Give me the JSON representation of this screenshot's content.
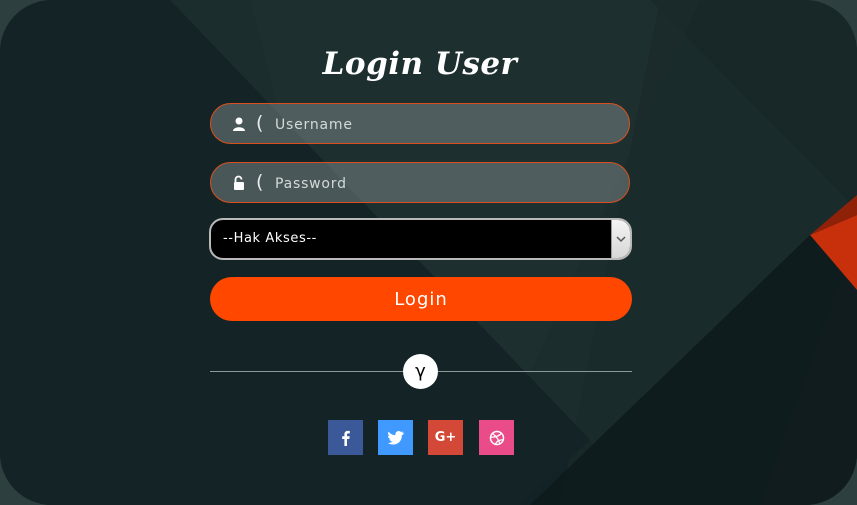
{
  "title": "Login User",
  "username": {
    "placeholder": "Username",
    "prefix": "(",
    "icon": "user-icon"
  },
  "password": {
    "placeholder": "Password",
    "prefix": "(",
    "icon": "unlock-icon"
  },
  "access": {
    "selected": "--Hak Akses--",
    "icon": "chevron-down-icon"
  },
  "login_button": "Login",
  "divider_symbol": "γ",
  "social": [
    {
      "name": "facebook",
      "icon": "facebook-icon",
      "glyph": "f",
      "color": "#3b5998"
    },
    {
      "name": "twitter",
      "icon": "twitter-icon",
      "glyph": "t",
      "color": "#4099ff"
    },
    {
      "name": "google-plus",
      "icon": "google-plus-icon",
      "glyph": "G+",
      "color": "#d34836"
    },
    {
      "name": "dribbble",
      "icon": "dribbble-icon",
      "glyph": "d",
      "color": "#ea4c89"
    }
  ],
  "colors": {
    "accent": "#ff4700",
    "background": "#132224",
    "field_border": "#d9501e"
  }
}
